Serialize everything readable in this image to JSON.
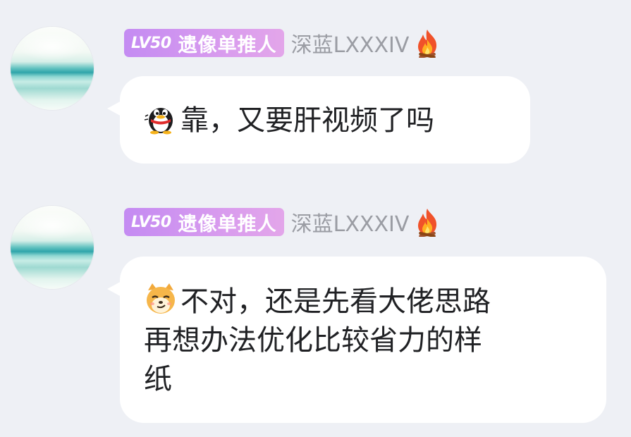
{
  "messages": [
    {
      "sender": {
        "level": "LV50",
        "title": "遗像单推人",
        "nickname": "深蓝LXXXIV",
        "flair_icon": "fire-icon"
      },
      "emoji": "qq-penguin-emoji",
      "text": "靠，又要肝视频了吗"
    },
    {
      "sender": {
        "level": "LV50",
        "title": "遗像单推人",
        "nickname": "深蓝LXXXIV",
        "flair_icon": "fire-icon"
      },
      "emoji": "smirk-dog-emoji",
      "text_lines": [
        "不对，还是先看大佬思路",
        "再想办法优化比较省力的样",
        "纸"
      ]
    }
  ],
  "colors": {
    "background": "#eef0f5",
    "bubble": "#ffffff",
    "badge_start": "#c48bf2",
    "badge_end": "#e3a6ea",
    "nickname": "#9a9ca3",
    "message_text": "#202124"
  }
}
